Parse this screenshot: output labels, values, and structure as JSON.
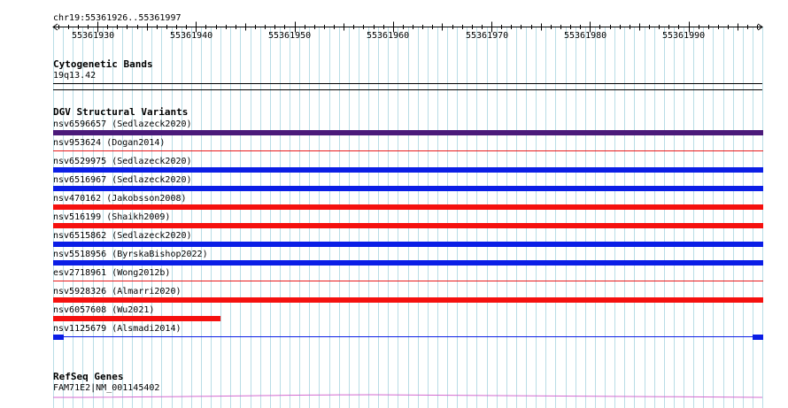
{
  "ruler": {
    "locus": "chr19:55361926..55361997",
    "start": 55361926,
    "end": 55361997,
    "tick_labels": [
      "55361930",
      "55361940",
      "55361950",
      "55361960",
      "55361970",
      "55361980",
      "55361990"
    ]
  },
  "tracks": {
    "cytoband": {
      "title": "Cytogenetic Bands",
      "band": "19q13.42"
    },
    "dgv": {
      "title": "DGV Structural Variants",
      "variants": [
        {
          "label": "nsv6596657 (Sedlazeck2020)",
          "color": "#4b1a7a",
          "style": "full"
        },
        {
          "label": "nsv953624 (Dogan2014)",
          "color": "#e8191b",
          "style": "thin"
        },
        {
          "label": "nsv6529975 (Sedlazeck2020)",
          "color": "#0b1ee6",
          "style": "full"
        },
        {
          "label": "nsv6516967 (Sedlazeck2020)",
          "color": "#0b1ee6",
          "style": "full"
        },
        {
          "label": "nsv470162 (Jakobsson2008)",
          "color": "#f5110f",
          "style": "full"
        },
        {
          "label": "nsv516199 (Shaikh2009)",
          "color": "#f5110f",
          "style": "full"
        },
        {
          "label": "nsv6515862 (Sedlazeck2020)",
          "color": "#0b1ee6",
          "style": "full"
        },
        {
          "label": "nsv5518956 (ByrskaBishop2022)",
          "color": "#0b1ee6",
          "style": "full"
        },
        {
          "label": "esv2718961 (Wong2012b)",
          "color": "#e8191b",
          "style": "thin"
        },
        {
          "label": "nsv5928326 (Almarri2020)",
          "color": "#f5110f",
          "style": "full"
        },
        {
          "label": "nsv6057608 (Wu2021)",
          "color": "#f5110f",
          "style": "partial",
          "end": 55361942
        },
        {
          "label": "nsv1125679 (Alsmadi2014)",
          "color": "#0b1ee6",
          "style": "line-caps"
        }
      ]
    },
    "refseq": {
      "title": "RefSeq Genes",
      "gene": "FAM71E2|NM_001145402",
      "color": "#d36ad0"
    }
  }
}
